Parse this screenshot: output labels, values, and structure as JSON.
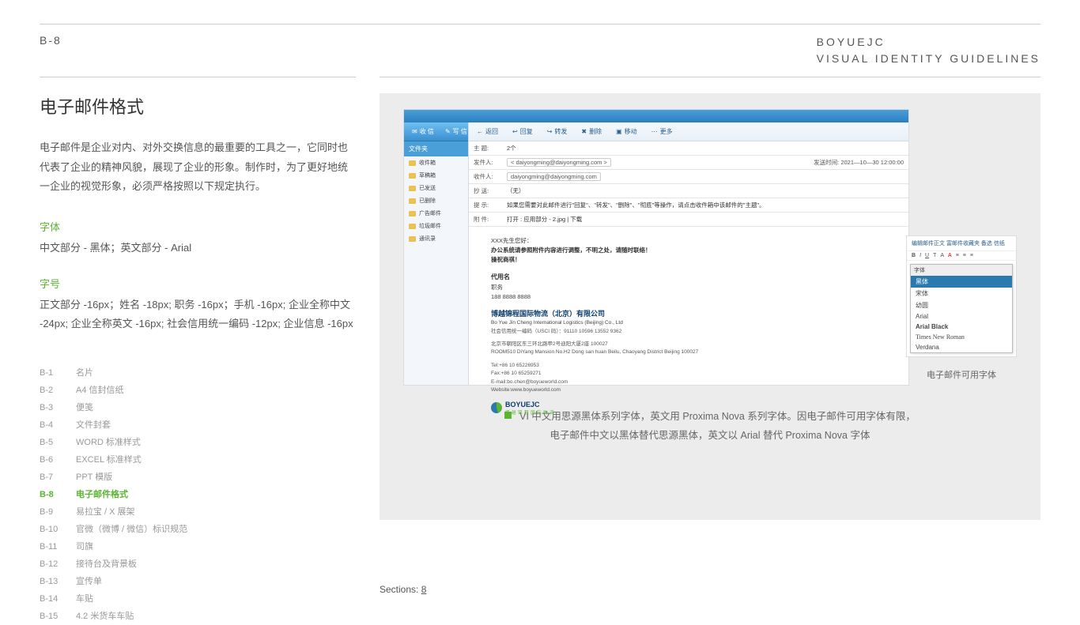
{
  "header": {
    "page_num": "B-8",
    "brand": "BOYUEJC",
    "subtitle": "VISUAL IDENTITY GUIDELINES"
  },
  "left": {
    "title": "电子邮件格式",
    "desc": "电子邮件是企业对内、对外交换信息的最重要的工具之一，它同时也代表了企业的精神风貌，展现了企业的形象。制作时，为了更好地统一企业的视觉形象，必须严格按照以下规定执行。",
    "font_label": "字体",
    "font_text": "中文部分 - 黑体；英文部分 - Arial",
    "size_label": "字号",
    "size_text": "正文部分 -16px；姓名 -18px; 职务 -16px；手机 -16px; 企业全称中文 -24px; 企业全称英文 -16px; 社会信用统一编码 -12px; 企业信息 -16px"
  },
  "toc": [
    {
      "code": "B-1",
      "label": "名片"
    },
    {
      "code": "B-2",
      "label": "A4 信封信纸"
    },
    {
      "code": "B-3",
      "label": "便笺"
    },
    {
      "code": "B-4",
      "label": "文件封套"
    },
    {
      "code": "B-5",
      "label": "WORD 标准样式"
    },
    {
      "code": "B-6",
      "label": "EXCEL 标准样式"
    },
    {
      "code": "B-7",
      "label": "PPT 模版"
    },
    {
      "code": "B-8",
      "label": "电子邮件格式"
    },
    {
      "code": "B-9",
      "label": "易拉宝 / X 展架"
    },
    {
      "code": "B-10",
      "label": "官微（微博 / 微信）标识规范"
    },
    {
      "code": "B-11",
      "label": "司旗"
    },
    {
      "code": "B-12",
      "label": "接待台及背景板"
    },
    {
      "code": "B-13",
      "label": "宣传单"
    },
    {
      "code": "B-14",
      "label": "车贴"
    },
    {
      "code": "B-15",
      "label": "4.2 米货车车贴"
    }
  ],
  "email": {
    "left_buttons": [
      "收 信",
      "写 信"
    ],
    "sidebar_title": "文件夹",
    "folders": [
      "收件箱",
      "草稿箱",
      "已发送",
      "已删除",
      "广告邮件",
      "垃圾邮件",
      "通讯录"
    ],
    "toolbar": [
      "返回",
      "回复",
      "转发",
      "删除",
      "移动",
      "更多"
    ],
    "subject_label": "主 题:",
    "subject": "2个",
    "from_label": "发件人:",
    "from": "< daiyongming@daiyongming.com >",
    "sent_label": "发送时间:",
    "sent": "2021—10—30  12:00:00",
    "to_label": "收件人:",
    "to": "daiyongming@daiyongming.com",
    "cc_label": "抄 送:",
    "cc": "（无）",
    "tip_label": "提 示:",
    "tip_text": "如果您需要对此邮件进行\"回复\"、\"转发\"、\"删除\"、\"彻底\"等操作，请点击收件箱中该邮件的\"主题\"。",
    "attach_label": "附 件:",
    "attach_text": "打开 : 应用部分 - 2.jpg  |  下载",
    "body1": "XXX先生您好：",
    "body2": "办公系统请参照附件内容进行调整，不明之处，请随时联络！",
    "body3": "操祝商祺！",
    "sig_name": "代用名",
    "sig_title": "职务",
    "sig_phone": "188 8888 8888",
    "company_cn": "博越锦程国际物流（北京）有限公司",
    "company_en": "Bo Yue Jin Cheng International Logistics (Beijing) Co., Ltd",
    "company_code": "社会信用统一编码（USCI 码）：91110 10596 13552 9362",
    "addr_cn": "北京市朝阳区东三环北路甲2号迪阳大厦2座 100027",
    "addr_en": "ROOM510 DiYang Mansion No.H2  Dong san huan Beilu, Chaoyang District Beijing 100027",
    "tel": "Tel:+86 10 65226953",
    "fax": "Fax:+86 10 65259271",
    "mail": "E-mail:bo.chen@boyueworld.com",
    "web": "Website:www.boyueworld.com",
    "logo_text": "BOYUEJC",
    "logo_sub": "博 越 锦 程 国 际 物 流"
  },
  "font_panel": {
    "toolbar": "编辑邮件正文  富邮件收藏夹  备选  信纸",
    "dd_head": "字体",
    "items": [
      "黑体",
      "宋体",
      "幼圆",
      "Arial",
      "Arial Black",
      "Times New Roman",
      "Verdana"
    ],
    "caption": "电子邮件可用字体"
  },
  "footer": {
    "line1": "VI 中文用思源黑体系列字体，英文用 Proxima Nova 系列字体。因电子邮件可用字体有限，",
    "line2": "电子邮件中文以黑体替代思源黑体，英文以 Arial 替代 Proxima Nova 字体"
  },
  "sections": {
    "label": "Sections:",
    "count": "8"
  }
}
